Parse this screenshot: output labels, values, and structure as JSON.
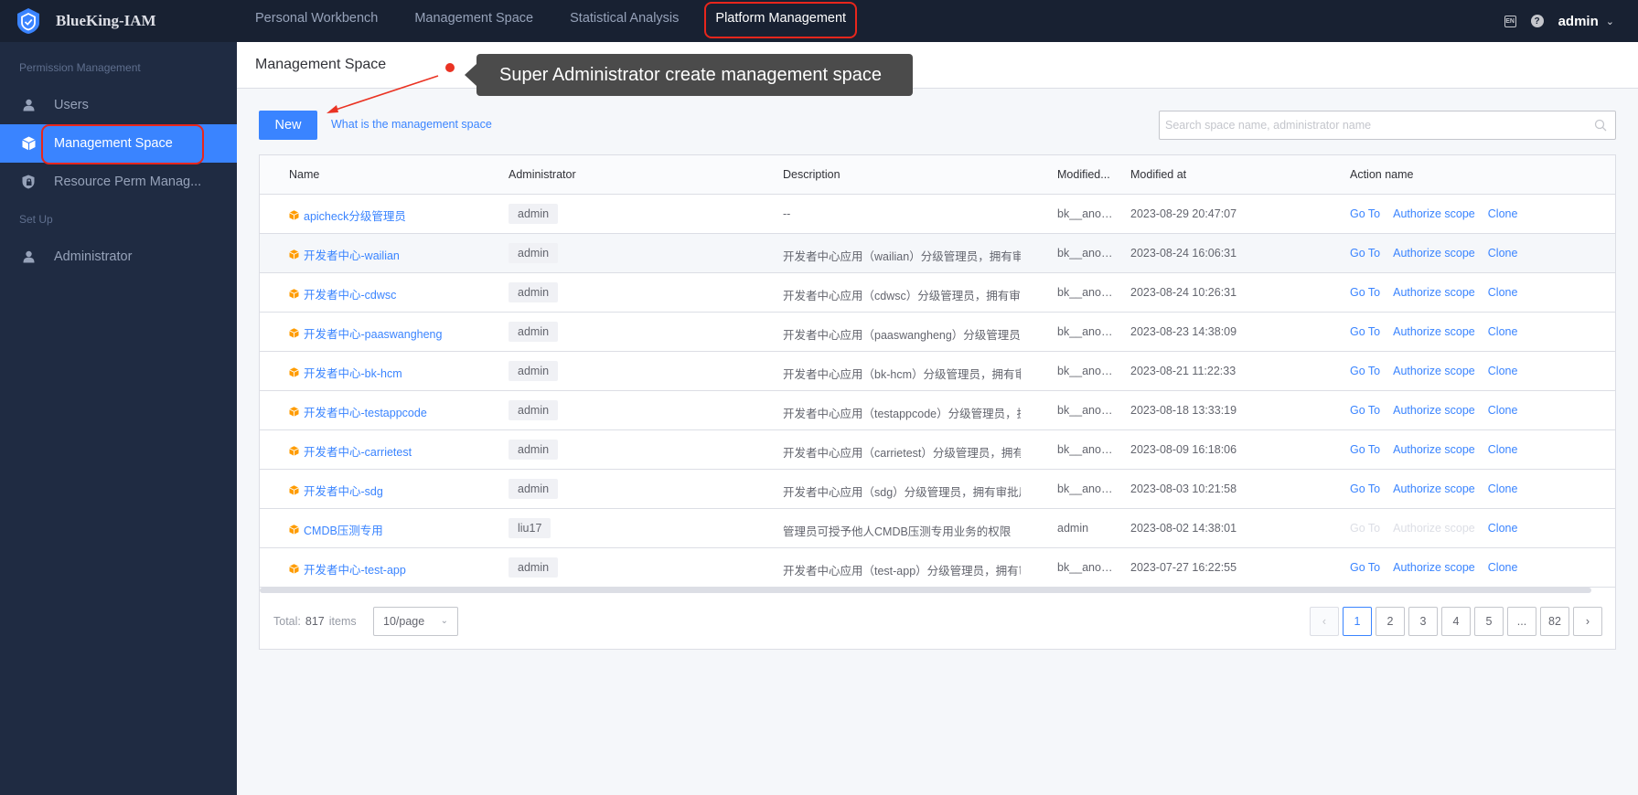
{
  "app": {
    "name": "BlueKing-IAM"
  },
  "nav": {
    "items": [
      {
        "label": "Personal Workbench"
      },
      {
        "label": "Management Space"
      },
      {
        "label": "Statistical Analysis"
      },
      {
        "label": "Platform Management"
      }
    ],
    "active": "Platform Management"
  },
  "topbar": {
    "user": "admin",
    "lang_icon_text": "EN",
    "help_icon_text": "?"
  },
  "sidebar": {
    "group1": "Permission Management",
    "items": [
      {
        "label": "Users",
        "icon": "user-icon"
      },
      {
        "label": "Management Space",
        "icon": "cube-icon"
      },
      {
        "label": "Resource Perm Manag...",
        "icon": "shield-lock-icon"
      }
    ],
    "group2": "Set Up",
    "items2": [
      {
        "label": "Administrator",
        "icon": "user-icon"
      }
    ]
  },
  "page": {
    "title": "Management Space"
  },
  "annotation": {
    "text": "Super Administrator create management space"
  },
  "toolbar": {
    "new_label": "New",
    "help_link": "What is the management space",
    "search_placeholder": "Search space name, administrator name"
  },
  "table": {
    "headers": {
      "name": "Name",
      "administrator": "Administrator",
      "description": "Description",
      "modified_by": "Modified...",
      "modified_at": "Modified at",
      "action": "Action name"
    },
    "rows": [
      {
        "name": "apicheck分级管理员",
        "admin": "admin",
        "desc": "--",
        "modified_by": "bk__anonymous",
        "modified_at": "2023-08-29 20:47:07",
        "enabled": true
      },
      {
        "name": "开发者中心-wailian",
        "admin": "admin",
        "desc": "开发者中心应用（wailian）分级管理员，拥有审批",
        "modified_by": "bk__anonymous",
        "modified_at": "2023-08-24 16:06:31",
        "enabled": true
      },
      {
        "name": "开发者中心-cdwsc",
        "admin": "admin",
        "desc": "开发者中心应用（cdwsc）分级管理员，拥有审批",
        "modified_by": "bk__anonymous",
        "modified_at": "2023-08-24 10:26:31",
        "enabled": true
      },
      {
        "name": "开发者中心-paaswangheng",
        "admin": "admin",
        "desc": "开发者中心应用（paaswangheng）分级管理员，",
        "modified_by": "bk__anonymous",
        "modified_at": "2023-08-23 14:38:09",
        "enabled": true
      },
      {
        "name": "开发者中心-bk-hcm",
        "admin": "admin",
        "desc": "开发者中心应用（bk-hcm）分级管理员，拥有审",
        "modified_by": "bk__anonymous",
        "modified_at": "2023-08-21 11:22:33",
        "enabled": true
      },
      {
        "name": "开发者中心-testappcode",
        "admin": "admin",
        "desc": "开发者中心应用（testappcode）分级管理员，拥",
        "modified_by": "bk__anonymous",
        "modified_at": "2023-08-18 13:33:19",
        "enabled": true
      },
      {
        "name": "开发者中心-carrietest",
        "admin": "admin",
        "desc": "开发者中心应用（carrietest）分级管理员，拥有",
        "modified_by": "bk__anonymous",
        "modified_at": "2023-08-09 16:18:06",
        "enabled": true
      },
      {
        "name": "开发者中心-sdg",
        "admin": "admin",
        "desc": "开发者中心应用（sdg）分级管理员，拥有审批用",
        "modified_by": "bk__anonymous",
        "modified_at": "2023-08-03 10:21:58",
        "enabled": true
      },
      {
        "name": "CMDB压测专用",
        "admin": "liu17",
        "desc": "管理员可授予他人CMDB压测专用业务的权限",
        "modified_by": "admin",
        "modified_at": "2023-08-02 14:38:01",
        "enabled": false
      },
      {
        "name": "开发者中心-test-app",
        "admin": "admin",
        "desc": "开发者中心应用（test-app）分级管理员，拥有审",
        "modified_by": "bk__anonymous",
        "modified_at": "2023-07-27 16:22:55",
        "enabled": true
      }
    ],
    "actions": {
      "goto": "Go To",
      "authorize": "Authorize scope",
      "clone": "Clone"
    }
  },
  "pagination": {
    "total_label": "Total:",
    "total": "817",
    "items_label": "items",
    "page_size": "10/page",
    "pages": [
      "1",
      "2",
      "3",
      "4",
      "5",
      "...",
      "82"
    ],
    "current": "1"
  },
  "colors": {
    "accent": "#3a84ff",
    "topbar": "#182132",
    "sidebar": "#1f2b42",
    "highlight": "#e8261c"
  }
}
